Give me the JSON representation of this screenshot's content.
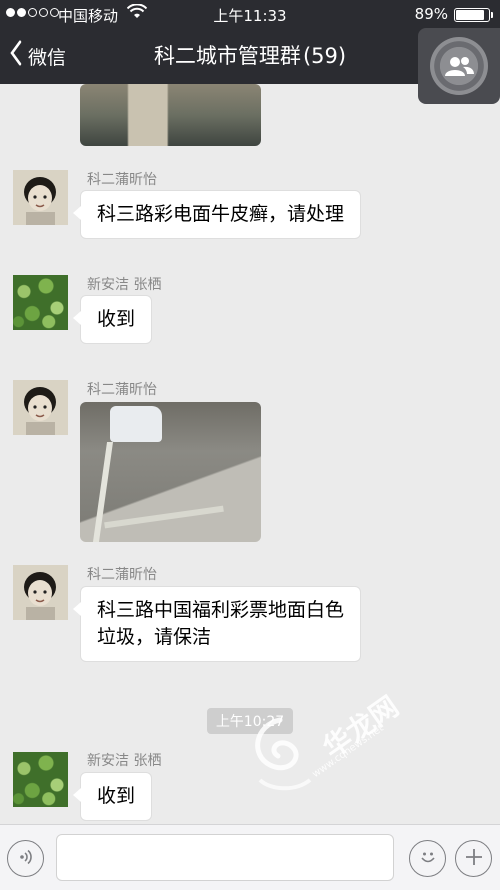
{
  "status_bar": {
    "carrier": "中国移动",
    "time": "上午11:33",
    "battery_percent": "89%",
    "battery_level": 0.89,
    "signal_bars": 2,
    "signal_total": 5
  },
  "nav": {
    "back_label": "微信",
    "title": "科二城市管理群",
    "member_count": "(59)"
  },
  "messages": [
    {
      "type": "image",
      "sender": "",
      "description": "street-photo-partial"
    },
    {
      "type": "text",
      "sender": "科二蒲昕怡",
      "text": "科三路彩电面牛皮癣，请处理"
    },
    {
      "type": "text",
      "sender": "新安洁 张栖",
      "text": "收到"
    },
    {
      "type": "image",
      "sender": "科二蒲昕怡"
    },
    {
      "type": "text",
      "sender": "科二蒲昕怡",
      "text_line1": "科三路中国福利彩票地面白色",
      "text_line2": "垃圾，请保洁"
    },
    {
      "type": "timestamp",
      "text": "上午10:27"
    },
    {
      "type": "text",
      "sender": "新安洁 张栖",
      "text": "收到"
    }
  ],
  "watermark": {
    "text": "华龙网",
    "url": "www.cqnews.net"
  },
  "input_bar": {
    "value": "",
    "placeholder": ""
  },
  "icons": {
    "voice": "voice-icon",
    "emoji": "emoji-icon",
    "add": "plus-icon",
    "group": "group-members-icon",
    "back": "chevron-left-icon"
  }
}
